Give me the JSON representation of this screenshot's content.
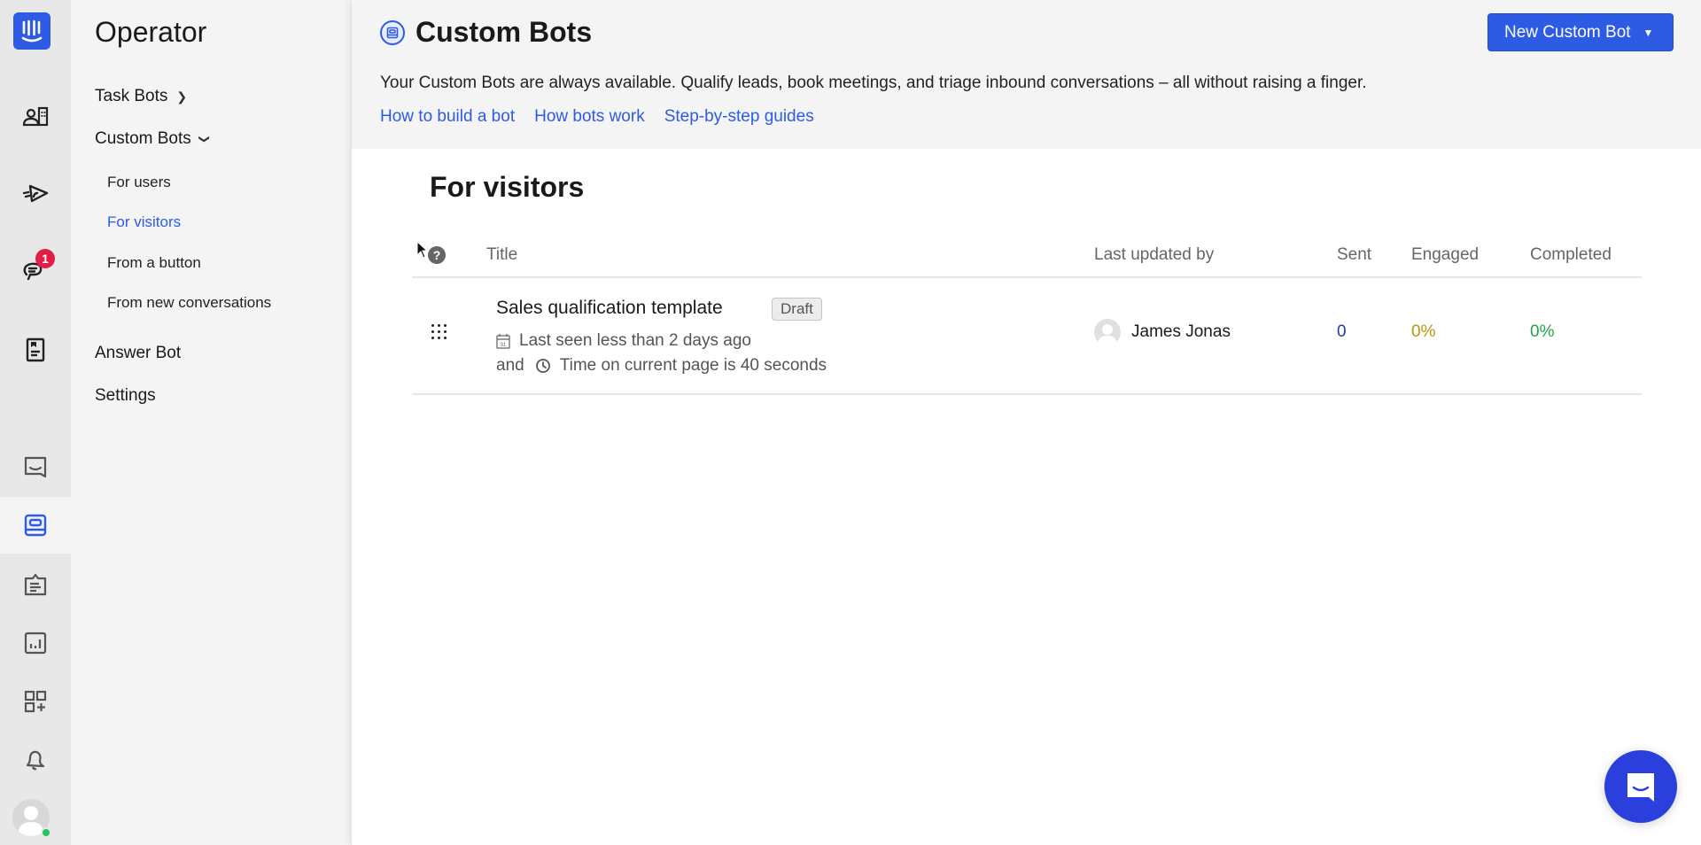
{
  "rail": {
    "items": [
      {
        "name": "logo",
        "icon": "intercom-logo-icon"
      },
      {
        "name": "contacts",
        "icon": "contacts-icon"
      },
      {
        "name": "outbound",
        "icon": "paper-plane-icon"
      },
      {
        "name": "inbox",
        "icon": "chat-bubbles-icon",
        "badge": "1"
      },
      {
        "name": "articles",
        "icon": "article-icon"
      },
      {
        "name": "messenger",
        "icon": "message-icon"
      },
      {
        "name": "operator",
        "icon": "bot-icon",
        "active": true
      },
      {
        "name": "reports-clipboard",
        "icon": "clipboard-icon"
      },
      {
        "name": "reports",
        "icon": "bar-chart-icon"
      },
      {
        "name": "app-store",
        "icon": "apps-plus-icon"
      },
      {
        "name": "notifications",
        "icon": "bell-icon"
      },
      {
        "name": "profile",
        "icon": "avatar-icon",
        "status": "online"
      }
    ]
  },
  "subnav": {
    "title": "Operator",
    "task_bots": "Task Bots",
    "custom_bots": "Custom Bots",
    "sub_items": [
      "For users",
      "For visitors",
      "From a button",
      "From new conversations"
    ],
    "active_sub": "For visitors",
    "answer_bot": "Answer Bot",
    "settings": "Settings"
  },
  "header": {
    "title": "Custom Bots",
    "description": "Your Custom Bots are always available. Qualify leads, book meetings, and triage inbound conversations – all without raising a finger.",
    "links": [
      "How to build a bot",
      "How bots work",
      "Step-by-step guides"
    ],
    "new_button": "New Custom Bot"
  },
  "section": {
    "title": "For visitors"
  },
  "table": {
    "columns": [
      "Title",
      "Last updated by",
      "Sent",
      "Engaged",
      "Completed"
    ],
    "rows": [
      {
        "title": "Sales qualification template",
        "status": "Draft",
        "rule_1": "Last seen less than 2 days ago",
        "conjunction": "and",
        "rule_2": "Time on current page is 40 seconds",
        "updated_by": "James Jonas",
        "sent": "0",
        "engaged": "0%",
        "completed": "0%"
      }
    ]
  },
  "colors": {
    "accent": "#2d5be3",
    "sent": "#1e3fa8",
    "engaged": "#b8960c",
    "completed": "#22a34a",
    "badge": "#e11d48",
    "online": "#22c55e"
  }
}
